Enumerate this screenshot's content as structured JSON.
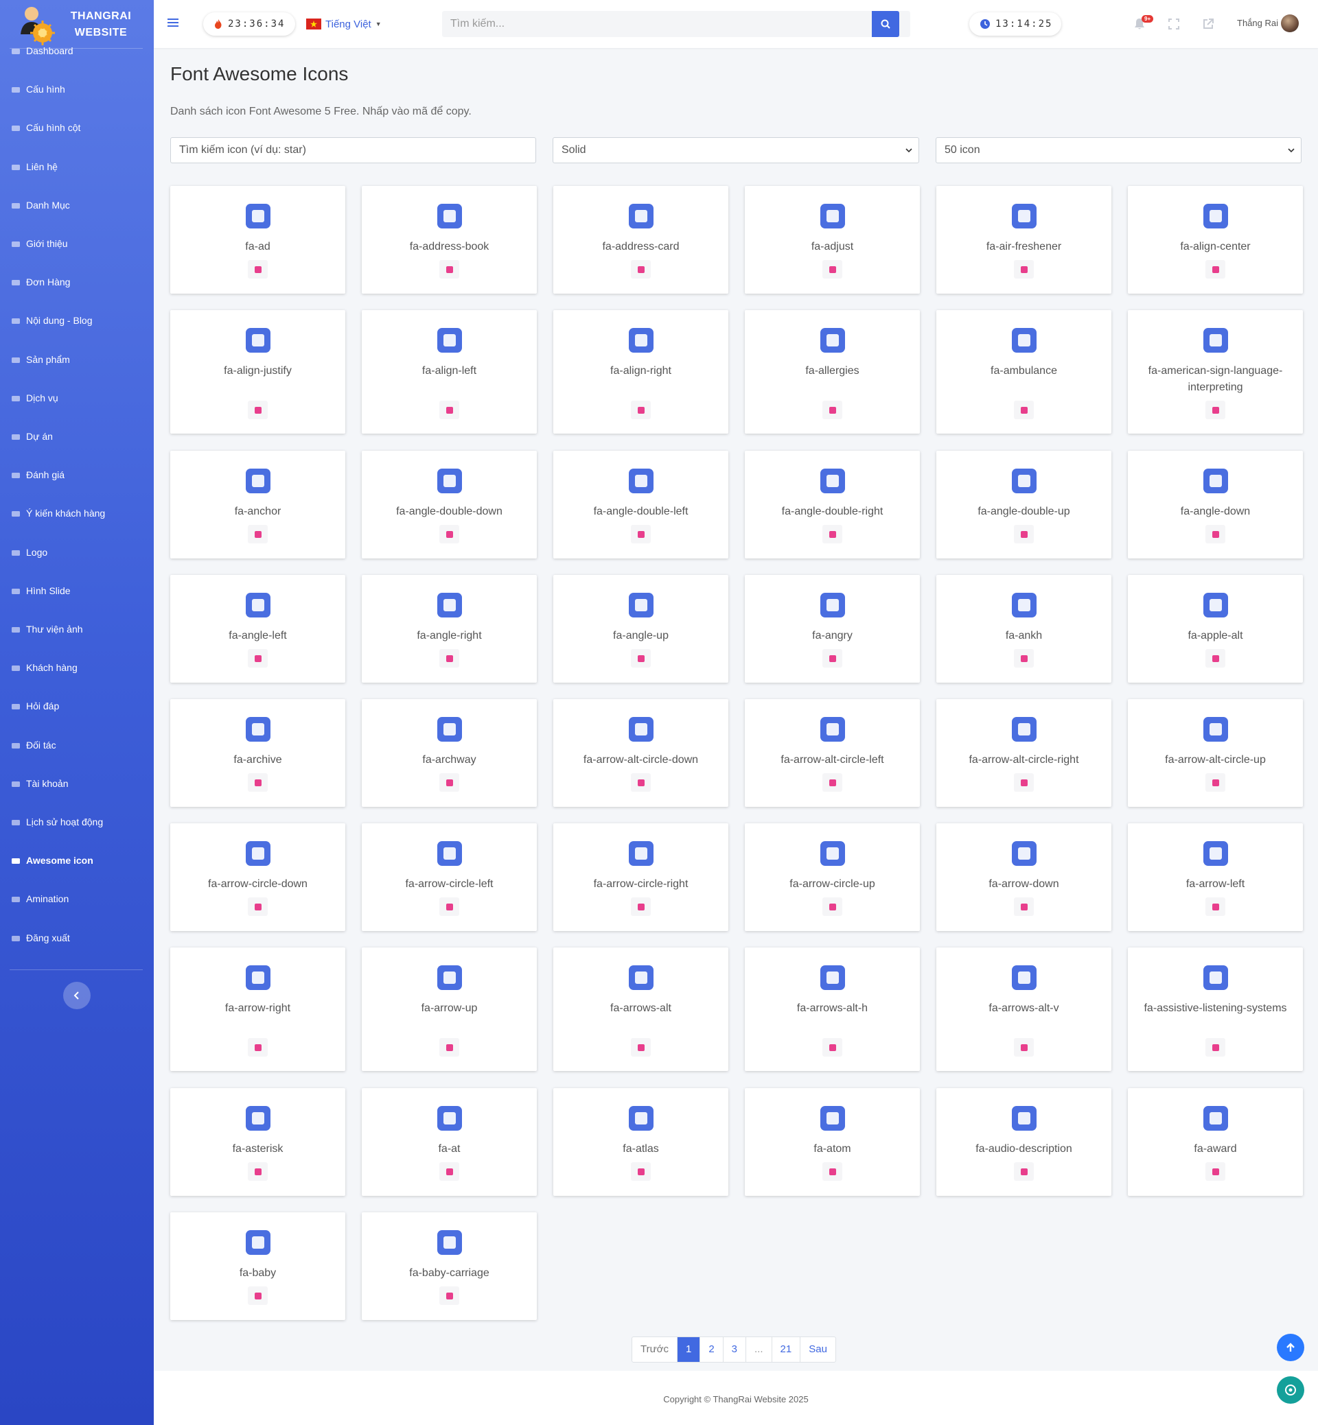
{
  "brand": {
    "title_line1": "THANGRAI",
    "title_line2": "WEBSITE"
  },
  "sidebar": {
    "items": [
      {
        "label": "Dashboard",
        "icon": "dashboard-icon"
      },
      {
        "label": "Cấu hình",
        "icon": "gears-icon"
      },
      {
        "label": "Cấu hình cột",
        "icon": "table-icon"
      },
      {
        "label": "Liên hệ",
        "icon": "envelope-icon"
      },
      {
        "label": "Danh Mục",
        "icon": "tags-icon"
      },
      {
        "label": "Giới thiệu",
        "icon": "file-icon"
      },
      {
        "label": "Đơn Hàng",
        "icon": "cart-icon"
      },
      {
        "label": "Nội dung - Blog",
        "icon": "blog-icon"
      },
      {
        "label": "Sản phẩm",
        "icon": "box-icon"
      },
      {
        "label": "Dịch vụ",
        "icon": "cloud-icon"
      },
      {
        "label": "Dự án",
        "icon": "folder-icon"
      },
      {
        "label": "Đánh giá",
        "icon": "star-icon"
      },
      {
        "label": "Ý kiến khách hàng",
        "icon": "comments-icon"
      },
      {
        "label": "Logo",
        "icon": "image-icon"
      },
      {
        "label": "Hình Slide",
        "icon": "images-icon"
      },
      {
        "label": "Thư viện ảnh",
        "icon": "gallery-icon"
      },
      {
        "label": "Khách hàng",
        "icon": "users-icon"
      },
      {
        "label": "Hỏi đáp",
        "icon": "question-icon"
      },
      {
        "label": "Đối tác",
        "icon": "partner-icon"
      },
      {
        "label": "Tài khoản",
        "icon": "user-cog-icon"
      },
      {
        "label": "Lịch sử hoạt động",
        "icon": "history-icon"
      },
      {
        "label": "Awesome icon",
        "icon": "list-icon",
        "active": true
      },
      {
        "label": "Amination",
        "icon": "film-icon"
      },
      {
        "label": "Đăng xuất",
        "icon": "sign-out-icon"
      }
    ]
  },
  "header": {
    "timer_left": "23:36:34",
    "language": "Tiếng Việt",
    "search_placeholder": "Tìm kiếm...",
    "timer_right": "13:14:25",
    "notification_badge": "9+",
    "user_name": "Thắng Rai"
  },
  "main": {
    "title": "Font Awesome Icons",
    "description": "Danh sách icon Font Awesome 5 Free. Nhấp vào mã để copy.",
    "filter_placeholder": "Tìm kiếm icon (ví dụ: star)",
    "style_select": "Solid",
    "count_select": "50 icon",
    "icons": [
      {
        "name": "fa-ad"
      },
      {
        "name": "fa-address-book"
      },
      {
        "name": "fa-address-card"
      },
      {
        "name": "fa-adjust"
      },
      {
        "name": "fa-air-freshener"
      },
      {
        "name": "fa-align-center"
      },
      {
        "name": "fa-align-justify"
      },
      {
        "name": "fa-align-left"
      },
      {
        "name": "fa-align-right"
      },
      {
        "name": "fa-allergies"
      },
      {
        "name": "fa-ambulance"
      },
      {
        "name": "fa-american-sign-language-interpreting"
      },
      {
        "name": "fa-anchor"
      },
      {
        "name": "fa-angle-double-down"
      },
      {
        "name": "fa-angle-double-left"
      },
      {
        "name": "fa-angle-double-right"
      },
      {
        "name": "fa-angle-double-up"
      },
      {
        "name": "fa-angle-down"
      },
      {
        "name": "fa-angle-left"
      },
      {
        "name": "fa-angle-right"
      },
      {
        "name": "fa-angle-up"
      },
      {
        "name": "fa-angry"
      },
      {
        "name": "fa-ankh"
      },
      {
        "name": "fa-apple-alt"
      },
      {
        "name": "fa-archive"
      },
      {
        "name": "fa-archway"
      },
      {
        "name": "fa-arrow-alt-circle-down"
      },
      {
        "name": "fa-arrow-alt-circle-left"
      },
      {
        "name": "fa-arrow-alt-circle-right"
      },
      {
        "name": "fa-arrow-alt-circle-up"
      },
      {
        "name": "fa-arrow-circle-down"
      },
      {
        "name": "fa-arrow-circle-left"
      },
      {
        "name": "fa-arrow-circle-right"
      },
      {
        "name": "fa-arrow-circle-up"
      },
      {
        "name": "fa-arrow-down"
      },
      {
        "name": "fa-arrow-left"
      },
      {
        "name": "fa-arrow-right"
      },
      {
        "name": "fa-arrow-up"
      },
      {
        "name": "fa-arrows-alt"
      },
      {
        "name": "fa-arrows-alt-h"
      },
      {
        "name": "fa-arrows-alt-v"
      },
      {
        "name": "fa-assistive-listening-systems"
      },
      {
        "name": "fa-asterisk"
      },
      {
        "name": "fa-at"
      },
      {
        "name": "fa-atlas"
      },
      {
        "name": "fa-atom"
      },
      {
        "name": "fa-audio-description"
      },
      {
        "name": "fa-award"
      },
      {
        "name": "fa-baby"
      },
      {
        "name": "fa-baby-carriage"
      }
    ]
  },
  "pagination": {
    "prev": "Trước",
    "pages": [
      "1",
      "2",
      "3",
      "...",
      "21"
    ],
    "next": "Sau",
    "active": "1"
  },
  "footer": {
    "copyright": "Copyright © ThangRai Website 2025"
  },
  "colors": {
    "accent": "#4169e1",
    "icon_blue": "#4a6ee0",
    "icon_pink": "#e83e8c"
  }
}
